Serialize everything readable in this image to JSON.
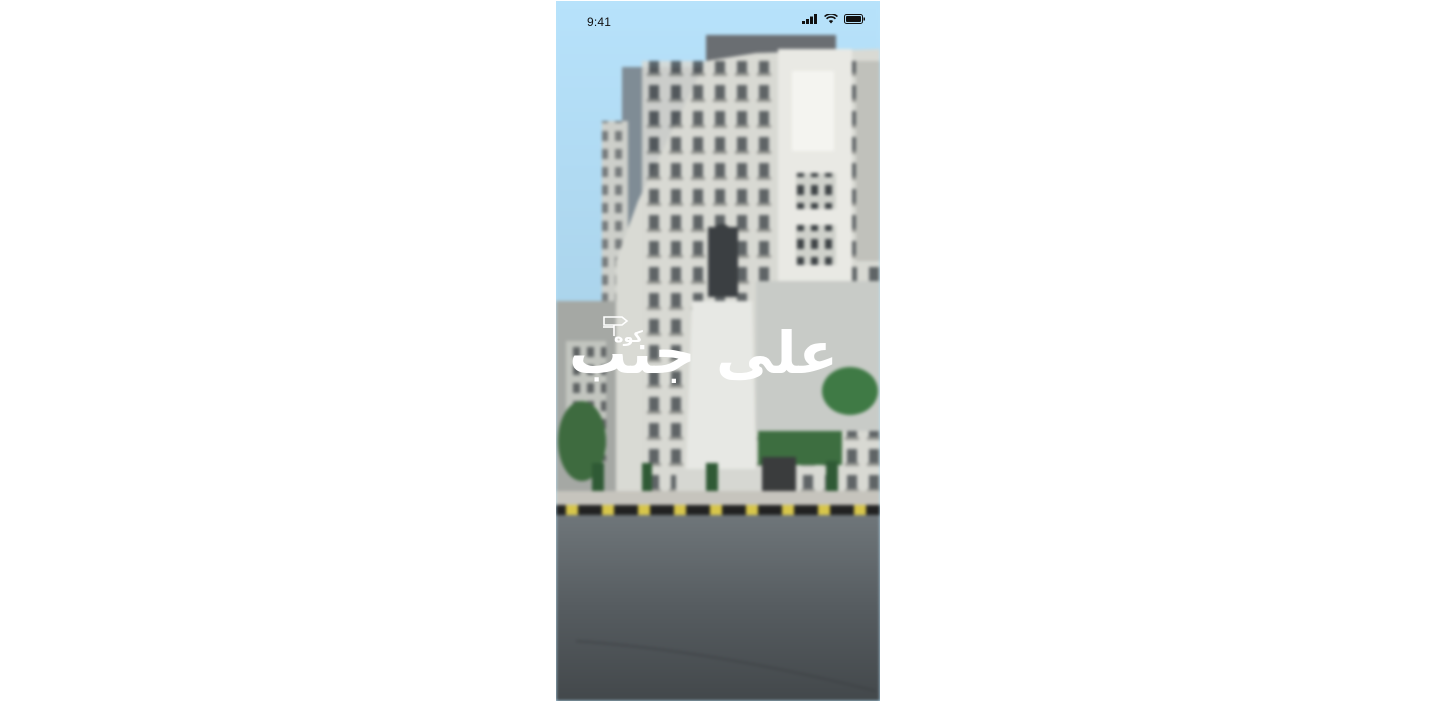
{
  "status_bar": {
    "time": "9:41",
    "icons": [
      "cellular-signal-icon",
      "wifi-icon",
      "battery-icon"
    ]
  },
  "splash": {
    "logo_main": "على جنب",
    "logo_small": "كوه",
    "logo_icon": "signpost-icon",
    "background": "street-photo-with-statue-and-buildings"
  },
  "colors": {
    "sky": "#b9e3fb",
    "road": "#4c5154",
    "logo": "#ffffff"
  }
}
